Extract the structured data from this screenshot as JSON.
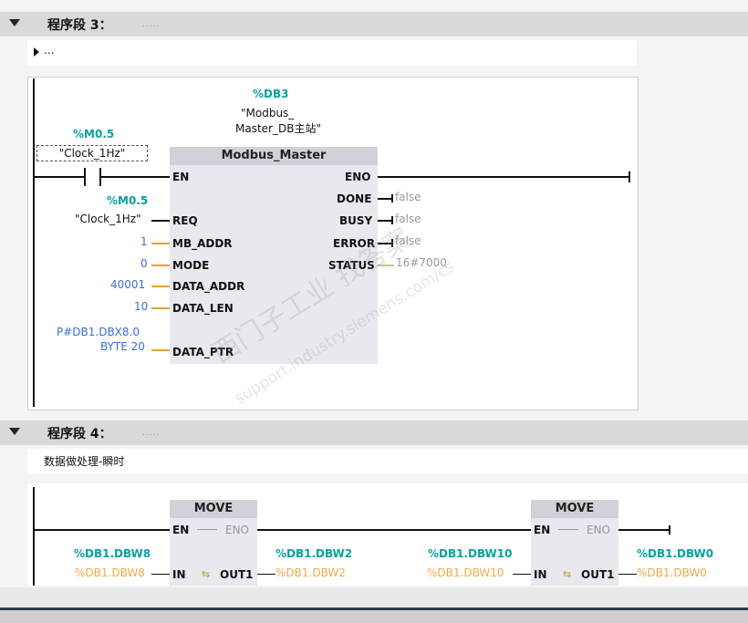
{
  "network3": {
    "title": "程序段 3：",
    "comment": ".....",
    "sub_comment": "...",
    "db_instance": "%DB3",
    "db_name_line1": "\"Modbus_",
    "db_name_line2": "Master_DB主站\"",
    "block_name": "Modbus_Master",
    "contact_addr": "%M0.5",
    "contact_name": "\"Clock_1Hz\"",
    "inputs": [
      {
        "pin": "EN",
        "tag": "",
        "value": ""
      },
      {
        "pin": "REQ",
        "tag": "%M0.5",
        "value": "\"Clock_1Hz\""
      },
      {
        "pin": "MB_ADDR",
        "value": "1"
      },
      {
        "pin": "MODE",
        "value": "0"
      },
      {
        "pin": "DATA_ADDR",
        "value": "40001"
      },
      {
        "pin": "DATA_LEN",
        "value": "10"
      },
      {
        "pin": "DATA_PTR",
        "value_line1": "P#DB1.DBX8.0",
        "value_line2": "BYTE 20"
      }
    ],
    "outputs": [
      {
        "pin": "ENO",
        "value": ""
      },
      {
        "pin": "DONE",
        "value": "false"
      },
      {
        "pin": "BUSY",
        "value": "false"
      },
      {
        "pin": "ERROR",
        "value": "false"
      },
      {
        "pin": "STATUS",
        "value": "16#7000"
      }
    ]
  },
  "network4": {
    "title": "程序段 4：",
    "comment": ".....",
    "description": "数据做处理-瞬时",
    "moves": [
      {
        "name": "MOVE",
        "en": "EN",
        "eno": "ENO",
        "in": "IN",
        "out": "OUT1",
        "in_addr": "%DB1.DBW8",
        "in_live": "%DB1.DBW8",
        "out_addr": "%DB1.DBW2",
        "out_live": "%DB1.DBW2"
      },
      {
        "name": "MOVE",
        "en": "EN",
        "eno": "ENO",
        "in": "IN",
        "out": "OUT1",
        "in_addr": "%DB1.DBW10",
        "in_live": "%DB1.DBW10",
        "out_addr": "%DB1.DBW0",
        "out_live": "%DB1.DBW0"
      }
    ]
  },
  "watermark": {
    "line1": "西门子工业 找答案",
    "line2": "support.industry.siemens.com/cs"
  },
  "colors": {
    "tag": "#0aa0a0",
    "constant": "#3a6fcf",
    "live": "#f0a94a",
    "header": "#d9d9d9",
    "block": "#e8e8ee"
  }
}
